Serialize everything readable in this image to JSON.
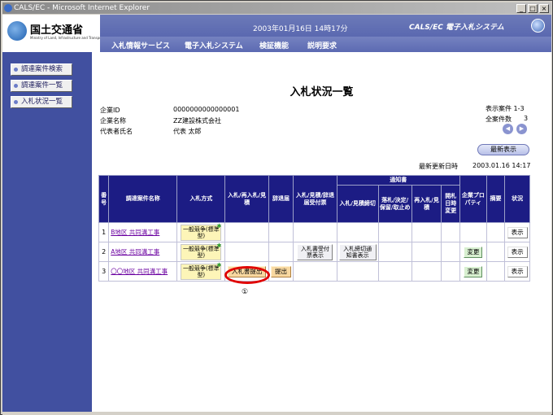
{
  "window": {
    "title": "CALS/EC - Microsoft Internet Explorer",
    "buttons": [
      "_",
      "□",
      "×"
    ]
  },
  "header": {
    "org_name": "国土交通省",
    "org_sub": "Ministry of Land, Infrastructure and Transport",
    "datetime": "2003年01月16日 14時17分",
    "system_name": "CALS/EC 電子入札システム",
    "menu": [
      "入札情報サービス",
      "電子入札システム",
      "検証機能",
      "説明要求"
    ]
  },
  "sidebar": {
    "items": [
      {
        "label": "調達案件検索"
      },
      {
        "label": "調達案件一覧"
      },
      {
        "label": "入札状況一覧"
      }
    ]
  },
  "main": {
    "title": "入札状況一覧",
    "company_id_label": "企業ID",
    "company_id": "0000000000000001",
    "company_name_label": "企業名称",
    "company_name": "ZZ建設株式会社",
    "rep_label": "代表者氏名",
    "rep_name": "代表 太郎",
    "display_count": "表示案件 1-3",
    "total_count_label": "全案件数",
    "total_count": "3",
    "refresh_label": "最新表示",
    "last_updated_label": "最新更新日時",
    "last_updated": "2003.01.16 14:17",
    "annotation": "①"
  },
  "table": {
    "headers": {
      "num": "番号",
      "name": "調達案件名称",
      "method": "入札方式",
      "bid": "入札/再入札/見積",
      "withdraw": "辞退届",
      "receipt": "入札/見積/辞退届受付票",
      "notice_group": "通知書",
      "notice_bid": "入札/見積締切",
      "notice_decision": "落札/決定/保留/取止め",
      "notice_rebid": "再入札/見積",
      "notice_date": "開札日時変更",
      "company": "企業プロパティ",
      "summary": "摘要",
      "status": "状況"
    },
    "rows": [
      {
        "num": "1",
        "name": "B地区 共同溝工事",
        "method": "一般競争(標準型)",
        "bid_btn": "",
        "withdraw_btn": "",
        "receipt_btn": "",
        "notice_bid_btn": "",
        "company_btn": "",
        "status_btn": "表示"
      },
      {
        "num": "2",
        "name": "A地区 共同溝工事",
        "method": "一般競争(標準型)",
        "bid_btn": "",
        "withdraw_btn": "",
        "receipt_btn": "入札書受付票表示",
        "notice_bid_btn": "入札締切通知書表示",
        "company_btn": "変更",
        "status_btn": "表示"
      },
      {
        "num": "3",
        "name": "〇〇地区 共同溝工事",
        "method": "一般競争(標準型)",
        "bid_btn": "入札書提出",
        "withdraw_btn": "提出",
        "receipt_btn": "",
        "notice_bid_btn": "",
        "company_btn": "変更",
        "status_btn": "表示"
      }
    ]
  }
}
